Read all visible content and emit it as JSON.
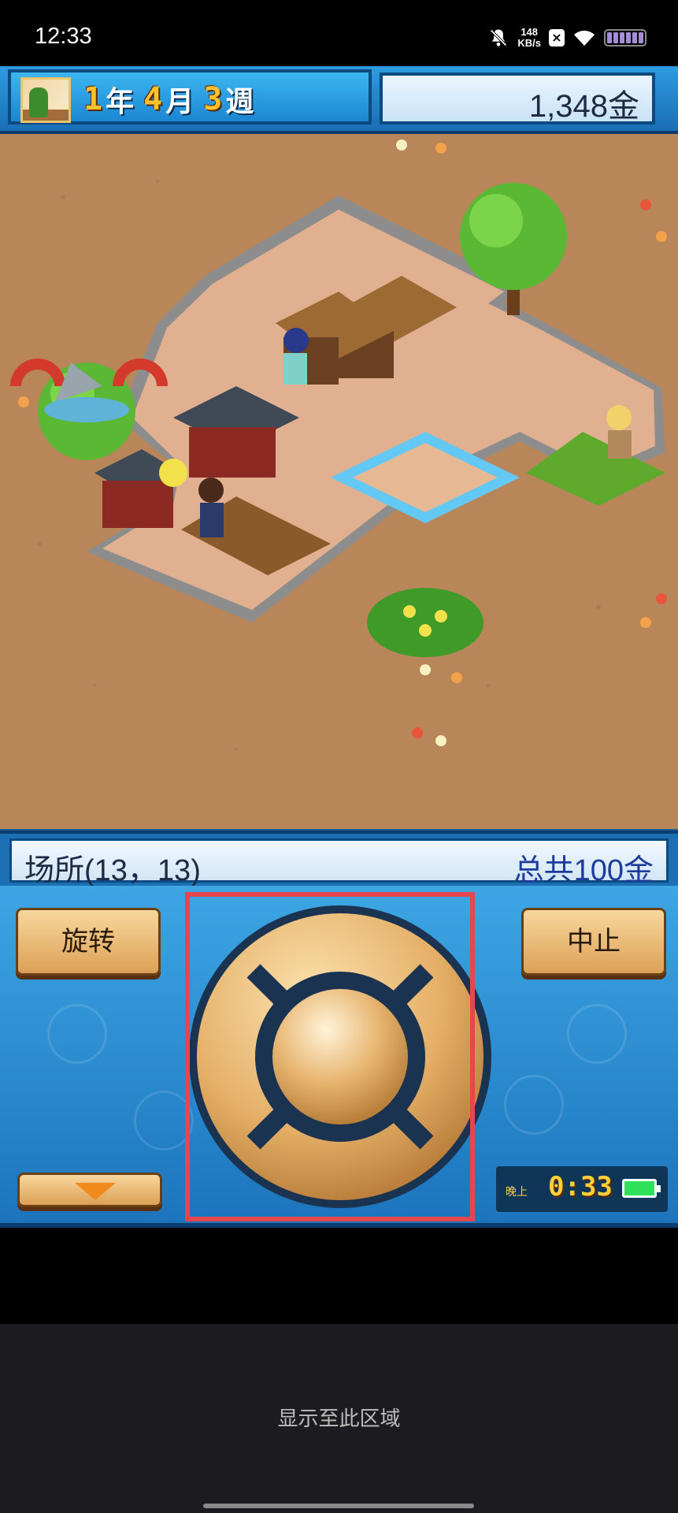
{
  "status_bar": {
    "time": "12:33",
    "net_speed_value": "148",
    "net_speed_unit": "KB/s",
    "icons": [
      "mute-bell-icon",
      "close-badge-icon",
      "wifi-icon",
      "battery-icon"
    ]
  },
  "header": {
    "year": "1",
    "year_unit": "年",
    "month": "4",
    "month_unit": "月",
    "week": "3",
    "week_unit": "週",
    "money": "1,348金"
  },
  "info_bar": {
    "location": "场所(13，13)",
    "total": "总共100金"
  },
  "controls": {
    "rotate_label": "旋转",
    "stop_label": "中止",
    "down_icon": "down-triangle-icon"
  },
  "clock": {
    "period": "晚上",
    "time": "0:33"
  },
  "bottom": {
    "message": "显示至此区域"
  },
  "colors": {
    "panel_blue": "#2a8fd6",
    "gold": "#ffc22d",
    "highlight": "#e6474e",
    "ground": "#b9865a"
  }
}
